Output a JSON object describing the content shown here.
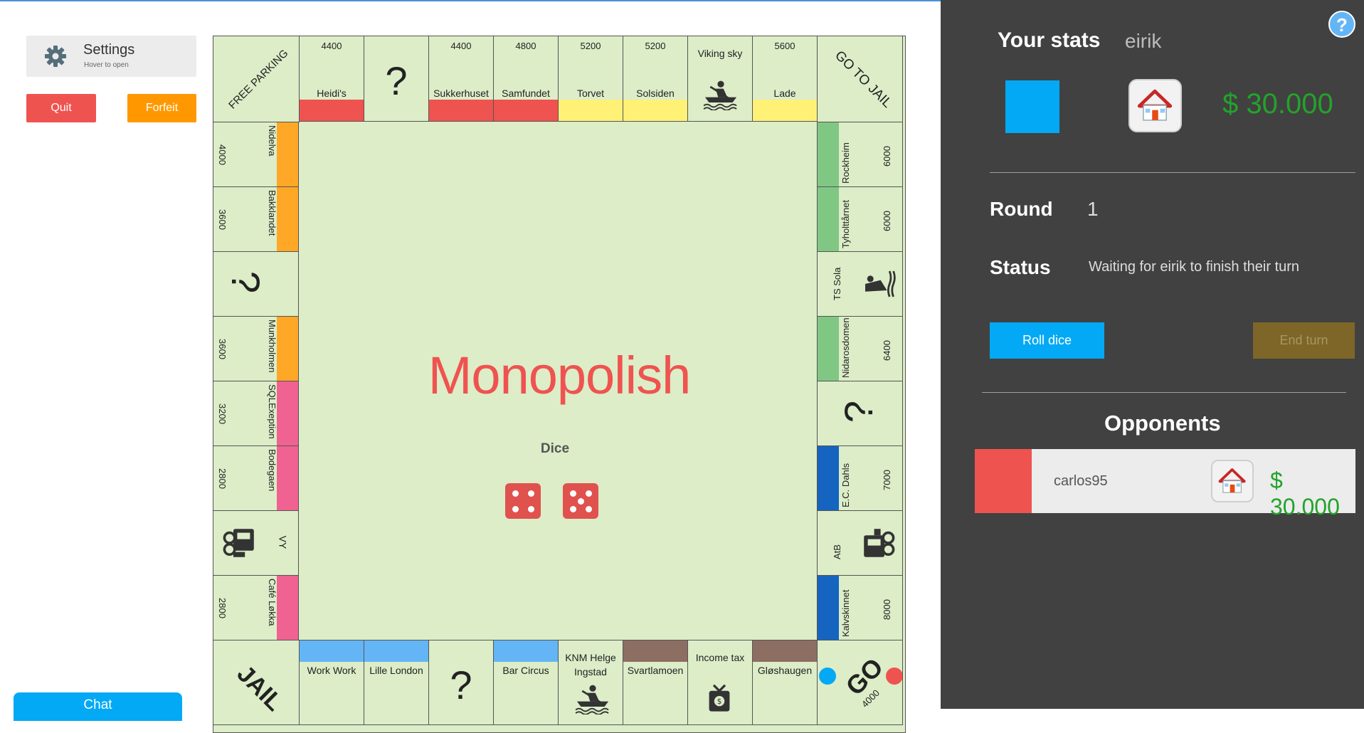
{
  "left": {
    "settings_title": "Settings",
    "settings_hint": "Hover to open",
    "quit": "Quit",
    "forfeit": "Forfeit",
    "chat": "Chat"
  },
  "board": {
    "corners": {
      "free_parking": "FREE PARKING",
      "go_to_jail": "GO TO JAIL",
      "jail": "JAIL",
      "go": "GO",
      "go_amount": "4000"
    },
    "top": [
      {
        "price": "4400",
        "name": "Heidi's",
        "color": "#ef5350"
      },
      {
        "price": "",
        "name": "?",
        "color": ""
      },
      {
        "price": "4400",
        "name": "Sukkerhuset",
        "color": "#ef5350"
      },
      {
        "price": "4800",
        "name": "Samfundet",
        "color": "#ef5350"
      },
      {
        "price": "5200",
        "name": "Torvet",
        "color": "#fff176"
      },
      {
        "price": "5200",
        "name": "Solsiden",
        "color": "#fff176"
      },
      {
        "price": "",
        "name": "Viking sky",
        "color": "",
        "icon": "rowboat-icon"
      },
      {
        "price": "5600",
        "name": "Lade",
        "color": "#fff176"
      }
    ],
    "left": [
      {
        "price": "4000",
        "name": "Nidelva",
        "color": "#ffa726"
      },
      {
        "price": "3600",
        "name": "Bakklandet",
        "color": "#ffa726"
      },
      {
        "price": "",
        "name": "?",
        "color": ""
      },
      {
        "price": "3600",
        "name": "Munkholmen",
        "color": "#ffa726"
      },
      {
        "price": "3200",
        "name": "SQLExeption",
        "color": "#f06292"
      },
      {
        "price": "2800",
        "name": "Bodegaen",
        "color": "#f06292"
      },
      {
        "price": "",
        "name": "VY",
        "color": "",
        "icon": "train-icon"
      },
      {
        "price": "2800",
        "name": "Café Løkka",
        "color": "#f06292"
      }
    ],
    "right": [
      {
        "price": "6000",
        "name": "Rockheim",
        "color": "#81c784"
      },
      {
        "price": "6000",
        "name": "Tyholttårnet",
        "color": "#81c784"
      },
      {
        "price": "",
        "name": "TS Sola",
        "color": "",
        "icon": "jetski-icon"
      },
      {
        "price": "6400",
        "name": "Nidarosdomen",
        "color": "#81c784"
      },
      {
        "price": "",
        "name": "?",
        "color": ""
      },
      {
        "price": "7000",
        "name": "E.C. Dahls",
        "color": "#1565c0"
      },
      {
        "price": "",
        "name": "AtB",
        "color": "",
        "icon": "bus-icon"
      },
      {
        "price": "8000",
        "name": "Kalvskinnet",
        "color": "#1565c0"
      }
    ],
    "bottom": [
      {
        "name": "Work Work",
        "color": "#64b5f6"
      },
      {
        "name": "Lille London",
        "color": "#64b5f6"
      },
      {
        "name": "?",
        "color": ""
      },
      {
        "name": "Bar Circus",
        "color": "#64b5f6"
      },
      {
        "name": "KNM Helge Ingstad",
        "color": "",
        "icon": "rowboat-icon"
      },
      {
        "name": "Svartlamoen",
        "color": "#8d6e63"
      },
      {
        "name": "Income tax",
        "color": "",
        "icon": "money-bag-icon"
      },
      {
        "name": "Gløshaugen",
        "color": "#8d6e63"
      }
    ],
    "title": "Monopolish",
    "dice_label": "Dice",
    "dice": [
      4,
      5
    ]
  },
  "stats": {
    "title": "Your stats",
    "player": "eirik",
    "player_color": "#03a9f4",
    "money": "$ 30.000",
    "round_label": "Round",
    "round_value": "1",
    "status_label": "Status",
    "status_value": "Waiting for eirik to finish their turn",
    "roll_dice": "Roll dice",
    "end_turn": "End turn"
  },
  "opponents": {
    "title": "Opponents",
    "list": [
      {
        "name": "carlos95",
        "color": "#ef5350",
        "money": "$ 30.000"
      }
    ]
  }
}
